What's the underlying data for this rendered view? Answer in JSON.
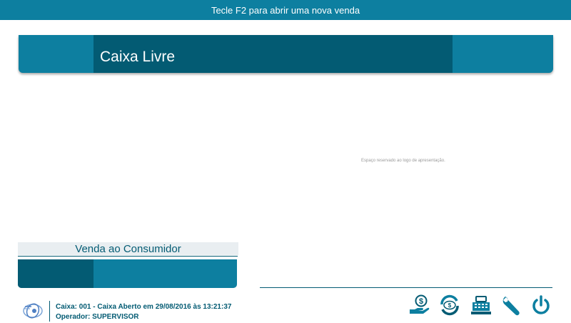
{
  "header": {
    "hint": "Tecle F2 para abrir uma nova venda"
  },
  "status": {
    "title": "Caixa Livre"
  },
  "logo_area": {
    "placeholder": "Espaço reservado ao logo de apresentação."
  },
  "sale": {
    "title": "Venda ao Consumidor"
  },
  "footer": {
    "caixa_label": "Caixa:",
    "caixa_value": "001 - Caixa Aberto em 29/08/2016 às 13:21:37",
    "operador_label": "Operador:",
    "operador_value": "SUPERVISOR"
  },
  "toolbar": {
    "buttons": [
      {
        "icon": "money-hand-icon"
      },
      {
        "icon": "money-exchange-icon"
      },
      {
        "icon": "cash-register-icon"
      },
      {
        "icon": "wrench-icon"
      },
      {
        "icon": "power-icon"
      }
    ]
  },
  "colors": {
    "primary": "#0d7fa0",
    "primary_dark": "#035b73",
    "light_gray": "#e9eef1"
  }
}
